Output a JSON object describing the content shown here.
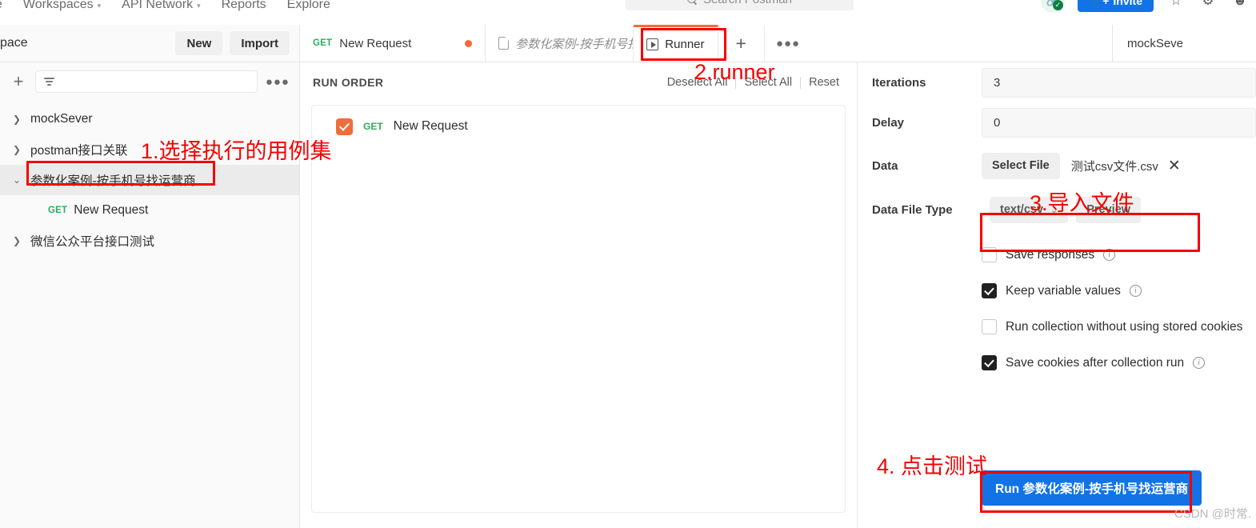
{
  "topnav": {
    "items": [
      {
        "label": "e",
        "caret": false
      },
      {
        "label": "Workspaces",
        "caret": true
      },
      {
        "label": "API Network",
        "caret": true
      },
      {
        "label": "Reports",
        "caret": false
      },
      {
        "label": "Explore",
        "caret": false
      }
    ],
    "search_placeholder": "Search Postman",
    "invite_label": "Invite",
    "sync_icon": "link-sync-icon",
    "settings_icon": "gear-icon",
    "notifications_icon": "bell-icon",
    "account_icon": "avatar-icon"
  },
  "sidebar": {
    "workspace_label": "kspace",
    "new_label": "New",
    "import_label": "Import",
    "filter_placeholder": "",
    "tree": [
      {
        "label": "mockSever",
        "expanded": false,
        "selected": false,
        "type": "collection"
      },
      {
        "label": "postman接口关联",
        "expanded": false,
        "selected": false,
        "type": "collection"
      },
      {
        "label": "参数化案例-按手机号找运营商",
        "expanded": true,
        "selected": true,
        "type": "collection"
      },
      {
        "label": "New Request",
        "method": "GET",
        "type": "request"
      },
      {
        "label": "微信公众平台接口测试",
        "expanded": false,
        "selected": false,
        "type": "collection"
      }
    ]
  },
  "tabs": {
    "request_tab": {
      "method": "GET",
      "label": "New Request",
      "unsaved": true
    },
    "collection_tab": {
      "label": "参数化案例-按手机号找运..."
    },
    "runner_tab": {
      "label": "Runner",
      "active": true
    },
    "new_tab_label": "+",
    "more_label": "•••",
    "environment": "mockSeve"
  },
  "runner": {
    "run_order_title": "RUN ORDER",
    "links": [
      "Deselect All",
      "Select All",
      "Reset"
    ],
    "requests": [
      {
        "checked": true,
        "method": "GET",
        "name": "New Request"
      }
    ],
    "settings": {
      "iterations_label": "Iterations",
      "iterations_value": "3",
      "delay_label": "Delay",
      "delay_value": "0",
      "data_label": "Data",
      "select_file_label": "Select File",
      "data_file_name": "测试csv文件.csv",
      "data_file_type_label": "Data File Type",
      "data_file_type_value": "text/csv",
      "preview_label": "Preview",
      "options": [
        {
          "label": "Save responses",
          "checked": false,
          "info": true
        },
        {
          "label": "Keep variable values",
          "checked": true,
          "info": true
        },
        {
          "label": "Run collection without using stored cookies",
          "checked": false,
          "info": false
        },
        {
          "label": "Save cookies after collection run",
          "checked": true,
          "info": true
        }
      ],
      "run_button_label": "Run 参数化案例-按手机号找运营商"
    }
  },
  "annotations": [
    {
      "id": "a1",
      "text": "1.选择执行的用例集"
    },
    {
      "id": "a2",
      "text": "2.runner"
    },
    {
      "id": "a3",
      "text": "3.导入文件"
    },
    {
      "id": "a4",
      "text": "4. 点击测试"
    }
  ],
  "watermark": "CSDN @时常.",
  "colors": {
    "accent_orange": "#f26b3a",
    "blue": "#1173e6",
    "green": "#27ae60",
    "annotation_red": "#f50000"
  }
}
